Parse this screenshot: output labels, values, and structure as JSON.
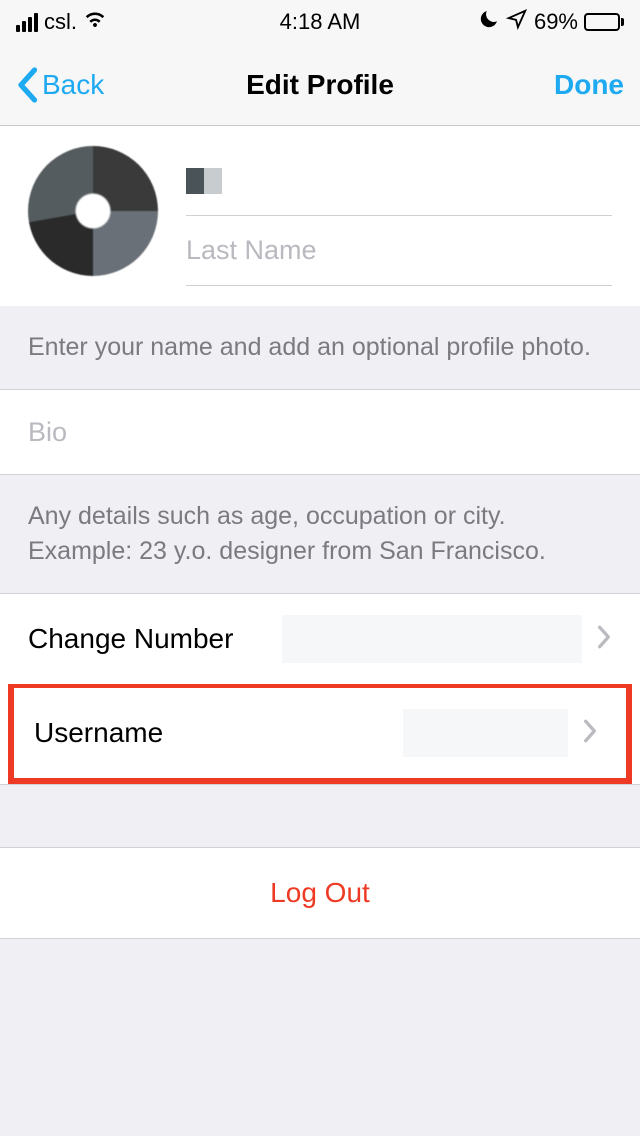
{
  "status": {
    "carrier": "csl.",
    "time": "4:18 AM",
    "battery_pct": "69%"
  },
  "nav": {
    "back": "Back",
    "title": "Edit Profile",
    "done": "Done"
  },
  "name": {
    "last_placeholder": "Last Name"
  },
  "helper1": "Enter your name and add an optional profile photo.",
  "bio": {
    "placeholder": "Bio"
  },
  "helper2": "Any details such as age, occupation or city. Example: 23 y.o. designer from San Francisco.",
  "rows": {
    "change_number": "Change Number",
    "username": "Username"
  },
  "logout": "Log Out"
}
